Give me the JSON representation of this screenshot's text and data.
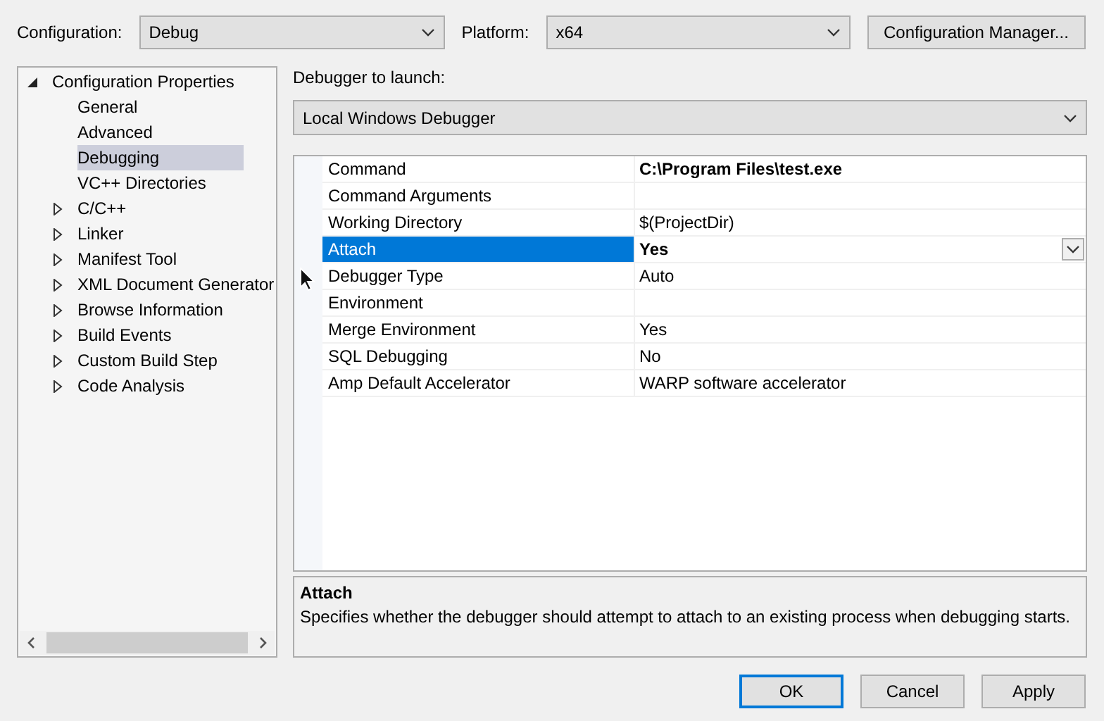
{
  "toolbar": {
    "configuration": {
      "label": "Configuration:",
      "value": "Debug"
    },
    "platform": {
      "label": "Platform:",
      "value": "x64"
    },
    "manager_button": "Configuration Manager..."
  },
  "tree": {
    "items": [
      {
        "label": "Configuration Properties",
        "kind": "folder",
        "expanded": true,
        "selected": false,
        "children": [
          {
            "label": "General",
            "kind": "page",
            "selected": false
          },
          {
            "label": "Advanced",
            "kind": "page",
            "selected": false
          },
          {
            "label": "Debugging",
            "kind": "page",
            "selected": true
          },
          {
            "label": "VC++ Directories",
            "kind": "page",
            "selected": false
          },
          {
            "label": "C/C++",
            "kind": "folder",
            "expanded": false,
            "selected": false
          },
          {
            "label": "Linker",
            "kind": "folder",
            "expanded": false,
            "selected": false
          },
          {
            "label": "Manifest Tool",
            "kind": "folder",
            "expanded": false,
            "selected": false
          },
          {
            "label": "XML Document Generator",
            "kind": "folder",
            "expanded": false,
            "selected": false
          },
          {
            "label": "Browse Information",
            "kind": "folder",
            "expanded": false,
            "selected": false
          },
          {
            "label": "Build Events",
            "kind": "folder",
            "expanded": false,
            "selected": false
          },
          {
            "label": "Custom Build Step",
            "kind": "folder",
            "expanded": false,
            "selected": false
          },
          {
            "label": "Code Analysis",
            "kind": "folder",
            "expanded": false,
            "selected": false
          }
        ]
      }
    ]
  },
  "debugger": {
    "label": "Debugger to launch:",
    "value": "Local Windows Debugger"
  },
  "properties": [
    {
      "name": "Command",
      "value": "C:\\Program Files\\test.exe",
      "modified": true,
      "selected": false
    },
    {
      "name": "Command Arguments",
      "modified": false,
      "selected": false
    },
    {
      "name": "Working Directory",
      "value": "$(ProjectDir)",
      "modified": false,
      "selected": false
    },
    {
      "name": "Attach",
      "value": "Yes",
      "modified": true,
      "selected": true
    },
    {
      "name": "Debugger Type",
      "value": "Auto",
      "modified": false,
      "selected": false
    },
    {
      "name": "Environment",
      "modified": false,
      "selected": false
    },
    {
      "name": "Merge Environment",
      "value": "Yes",
      "modified": false,
      "selected": false
    },
    {
      "name": "SQL Debugging",
      "value": "No",
      "modified": false,
      "selected": false
    },
    {
      "name": "Amp Default Accelerator",
      "value": "WARP software accelerator",
      "modified": false,
      "selected": false
    }
  ],
  "description": {
    "title": "Attach",
    "text": "Specifies whether the debugger should attempt to attach to an existing process when debugging starts."
  },
  "buttons": [
    {
      "label": "OK",
      "default": true
    },
    {
      "label": "Cancel",
      "default": false
    },
    {
      "label": "Apply",
      "default": false
    }
  ]
}
